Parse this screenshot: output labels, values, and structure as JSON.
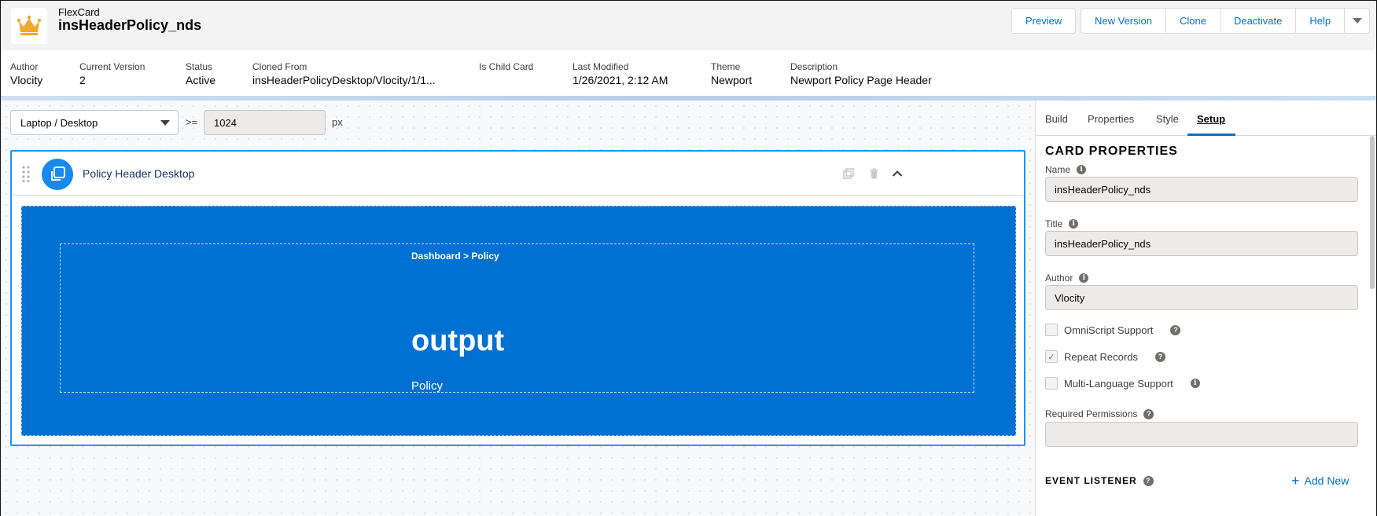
{
  "header": {
    "object_label": "FlexCard",
    "record_title": "insHeaderPolicy_nds",
    "buttons": [
      "Preview",
      "New Version",
      "Clone",
      "Deactivate",
      "Help"
    ]
  },
  "highlights": [
    {
      "label": "Author",
      "value": "Vlocity"
    },
    {
      "label": "Current Version",
      "value": "2"
    },
    {
      "label": "Status",
      "value": "Active"
    },
    {
      "label": "Cloned From",
      "value": "insHeaderPolicyDesktop/Vlocity/1/1..."
    },
    {
      "label": "Is Child Card",
      "value": ""
    },
    {
      "label": "Last Modified",
      "value": "1/26/2021, 2:12 AM"
    },
    {
      "label": "Theme",
      "value": "Newport"
    },
    {
      "label": "Description",
      "value": "Newport Policy Page Header"
    }
  ],
  "canvas": {
    "device": "Laptop / Desktop",
    "operator": ">=",
    "width_value": "1024",
    "unit": "px",
    "card_title": "Policy Header Desktop",
    "breadcrumb": "Dashboard > Policy",
    "output_title": "output",
    "output_subtitle": "Policy"
  },
  "side_panel": {
    "tabs": [
      "Build",
      "Properties",
      "Style",
      "Setup"
    ],
    "active_tab": "Setup",
    "section_title": "CARD PROPERTIES",
    "fields": {
      "name": {
        "label": "Name",
        "value": "insHeaderPolicy_nds"
      },
      "title": {
        "label": "Title",
        "value": "insHeaderPolicy_nds"
      },
      "author": {
        "label": "Author",
        "value": "Vlocity"
      }
    },
    "checkboxes": [
      {
        "label": "OmniScript Support",
        "checked": false
      },
      {
        "label": "Repeat Records",
        "checked": true
      },
      {
        "label": "Multi-Language Support",
        "checked": false
      }
    ],
    "required_permissions_label": "Required Permissions",
    "event_listener_title": "EVENT LISTENER",
    "add_new_label": "Add New"
  },
  "colors": {
    "brand_blue": "#0070d2",
    "card_border": "#1b96ff",
    "icon_orange": "#f0a830"
  }
}
